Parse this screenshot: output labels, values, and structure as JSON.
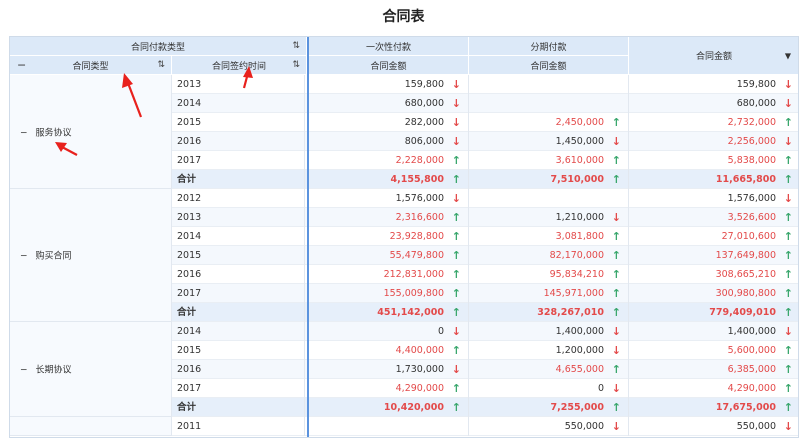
{
  "title": "合同表",
  "colors": {
    "header_bg": "#dce9f8",
    "accent_line": "#5b93de",
    "up": "#3aa76d",
    "down": "#e34a4a",
    "red_value": "#e34a4a"
  },
  "header": {
    "row_dim_top": "合同付款类型",
    "dim1": "合同类型",
    "dim2": "合同签约时间",
    "col_group1": "一次性付款",
    "col_group2": "分期付款",
    "col_sub1": "合同金额",
    "col_sub2": "合同金额",
    "col_total": "合同金额",
    "sort_icon": "sort-icon",
    "collapse_icon": "minus-icon",
    "dropdown_icon": "caret-down-icon"
  },
  "groups": [
    {
      "label": "服务协议",
      "rows": [
        {
          "year": "2013",
          "v1": "159,800",
          "d1": "down",
          "r1": false,
          "v2": "",
          "d2": "",
          "r2": false,
          "v3": "159,800",
          "d3": "down",
          "r3": false
        },
        {
          "year": "2014",
          "v1": "680,000",
          "d1": "down",
          "r1": false,
          "v2": "",
          "d2": "",
          "r2": false,
          "v3": "680,000",
          "d3": "down",
          "r3": false
        },
        {
          "year": "2015",
          "v1": "282,000",
          "d1": "down",
          "r1": false,
          "v2": "2,450,000",
          "d2": "up",
          "r2": true,
          "v3": "2,732,000",
          "d3": "up",
          "r3": true
        },
        {
          "year": "2016",
          "v1": "806,000",
          "d1": "down",
          "r1": false,
          "v2": "1,450,000",
          "d2": "down",
          "r2": false,
          "v3": "2,256,000",
          "d3": "down",
          "r3": true
        },
        {
          "year": "2017",
          "v1": "2,228,000",
          "d1": "up",
          "r1": true,
          "v2": "3,610,000",
          "d2": "up",
          "r2": true,
          "v3": "5,838,000",
          "d3": "up",
          "r3": true
        },
        {
          "year": "合计",
          "v1": "4,155,800",
          "d1": "up",
          "r1": true,
          "v2": "7,510,000",
          "d2": "up",
          "r2": true,
          "v3": "11,665,800",
          "d3": "up",
          "r3": true,
          "total": true
        }
      ]
    },
    {
      "label": "购买合同",
      "rows": [
        {
          "year": "2012",
          "v1": "1,576,000",
          "d1": "down",
          "r1": false,
          "v2": "",
          "d2": "",
          "r2": false,
          "v3": "1,576,000",
          "d3": "down",
          "r3": false
        },
        {
          "year": "2013",
          "v1": "2,316,600",
          "d1": "up",
          "r1": true,
          "v2": "1,210,000",
          "d2": "down",
          "r2": false,
          "v3": "3,526,600",
          "d3": "up",
          "r3": true
        },
        {
          "year": "2014",
          "v1": "23,928,800",
          "d1": "up",
          "r1": true,
          "v2": "3,081,800",
          "d2": "up",
          "r2": true,
          "v3": "27,010,600",
          "d3": "up",
          "r3": true
        },
        {
          "year": "2015",
          "v1": "55,479,800",
          "d1": "up",
          "r1": true,
          "v2": "82,170,000",
          "d2": "up",
          "r2": true,
          "v3": "137,649,800",
          "d3": "up",
          "r3": true
        },
        {
          "year": "2016",
          "v1": "212,831,000",
          "d1": "up",
          "r1": true,
          "v2": "95,834,210",
          "d2": "up",
          "r2": true,
          "v3": "308,665,210",
          "d3": "up",
          "r3": true
        },
        {
          "year": "2017",
          "v1": "155,009,800",
          "d1": "up",
          "r1": true,
          "v2": "145,971,000",
          "d2": "up",
          "r2": true,
          "v3": "300,980,800",
          "d3": "up",
          "r3": true
        },
        {
          "year": "合计",
          "v1": "451,142,000",
          "d1": "up",
          "r1": true,
          "v2": "328,267,010",
          "d2": "up",
          "r2": true,
          "v3": "779,409,010",
          "d3": "up",
          "r3": true,
          "total": true
        }
      ]
    },
    {
      "label": "长期协议",
      "rows": [
        {
          "year": "2014",
          "v1": "0",
          "d1": "down",
          "r1": false,
          "v2": "1,400,000",
          "d2": "down",
          "r2": false,
          "v3": "1,400,000",
          "d3": "down",
          "r3": false
        },
        {
          "year": "2015",
          "v1": "4,400,000",
          "d1": "up",
          "r1": true,
          "v2": "1,200,000",
          "d2": "down",
          "r2": false,
          "v3": "5,600,000",
          "d3": "up",
          "r3": true
        },
        {
          "year": "2016",
          "v1": "1,730,000",
          "d1": "down",
          "r1": false,
          "v2": "4,655,000",
          "d2": "up",
          "r2": true,
          "v3": "6,385,000",
          "d3": "up",
          "r3": true
        },
        {
          "year": "2017",
          "v1": "4,290,000",
          "d1": "up",
          "r1": true,
          "v2": "0",
          "d2": "down",
          "r2": false,
          "v3": "4,290,000",
          "d3": "up",
          "r3": true
        },
        {
          "year": "合计",
          "v1": "10,420,000",
          "d1": "up",
          "r1": true,
          "v2": "7,255,000",
          "d2": "up",
          "r2": true,
          "v3": "17,675,000",
          "d3": "up",
          "r3": true,
          "total": true
        }
      ]
    },
    {
      "label": "",
      "rows": [
        {
          "year": "2011",
          "v1": "",
          "d1": "",
          "r1": false,
          "v2": "550,000",
          "d2": "down",
          "r2": false,
          "v3": "550,000",
          "d3": "down",
          "r3": false
        }
      ]
    }
  ]
}
